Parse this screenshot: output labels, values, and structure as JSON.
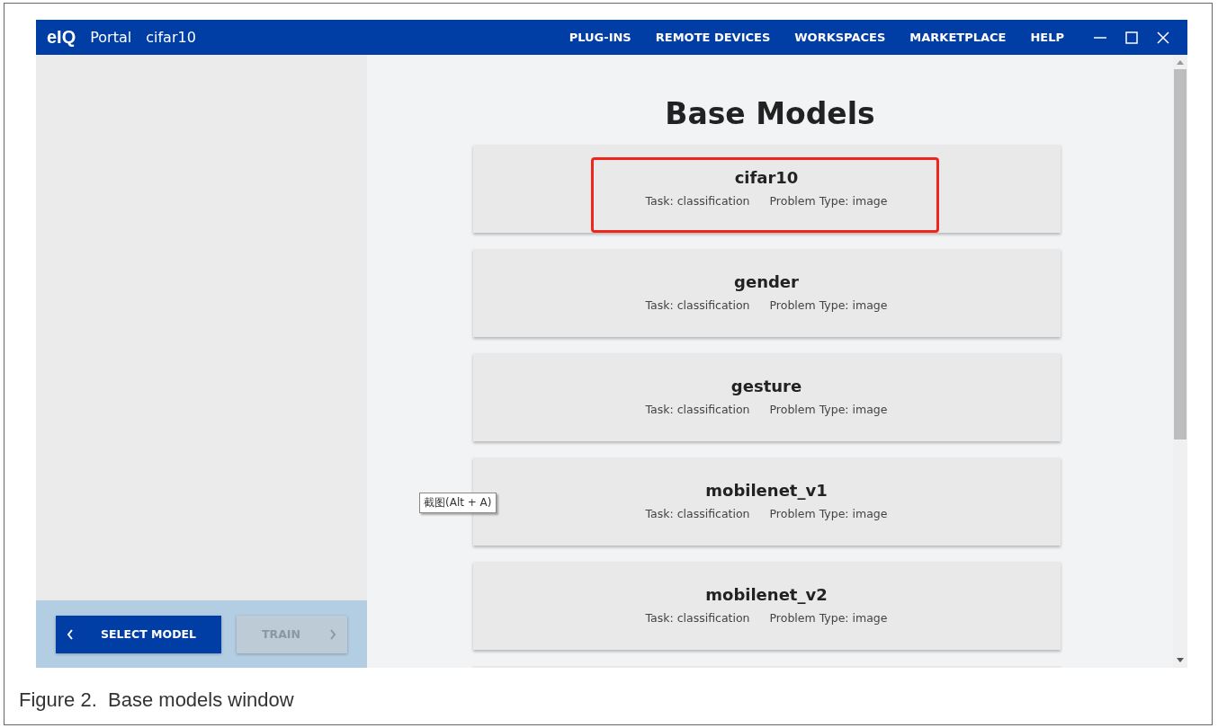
{
  "window": {
    "logo": "eIQ",
    "app": "Portal",
    "project": "cifar10"
  },
  "nav": [
    "PLUG-INS",
    "REMOTE DEVICES",
    "WORKSPACES",
    "MARKETPLACE",
    "HELP"
  ],
  "heading": "Base Models",
  "models": [
    {
      "name": "cifar10",
      "task": "Task: classification",
      "problem": "Problem Type: image",
      "highlighted": true
    },
    {
      "name": "gender",
      "task": "Task: classification",
      "problem": "Problem Type: image",
      "highlighted": false
    },
    {
      "name": "gesture",
      "task": "Task: classification",
      "problem": "Problem Type: image",
      "highlighted": false
    },
    {
      "name": "mobilenet_v1",
      "task": "Task: classification",
      "problem": "Problem Type: image",
      "highlighted": false
    },
    {
      "name": "mobilenet_v2",
      "task": "Task: classification",
      "problem": "Problem Type: image",
      "highlighted": false
    }
  ],
  "tooltip": "截图(Alt + A)",
  "buttons": [
    {
      "label": "SELECT MODEL",
      "disabled": false
    },
    {
      "label": "TRAIN",
      "disabled": true
    }
  ],
  "caption": "Figure 2.  Base models window"
}
